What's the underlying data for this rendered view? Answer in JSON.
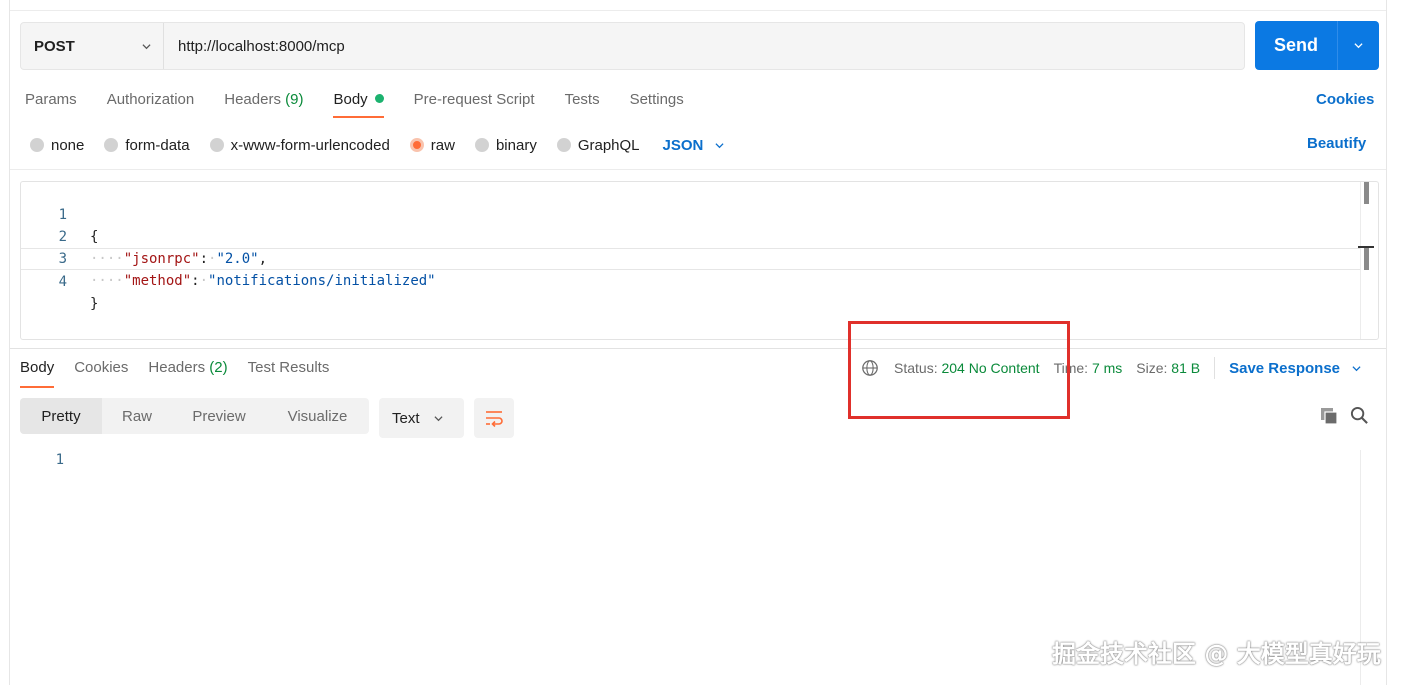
{
  "request": {
    "method": "POST",
    "url": "http://localhost:8000/mcp",
    "send_label": "Send"
  },
  "request_tabs": [
    {
      "label": "Params",
      "active": false
    },
    {
      "label": "Authorization",
      "active": false
    },
    {
      "label": "Headers",
      "count": "(9)",
      "active": false
    },
    {
      "label": "Body",
      "active": true
    },
    {
      "label": "Pre-request Script",
      "active": false
    },
    {
      "label": "Tests",
      "active": false
    },
    {
      "label": "Settings",
      "active": false
    }
  ],
  "cookies_label": "Cookies",
  "body_types": [
    "none",
    "form-data",
    "x-www-form-urlencoded",
    "raw",
    "binary",
    "GraphQL"
  ],
  "body_type_selected": "raw",
  "body_format": "JSON",
  "beautify_label": "Beautify",
  "editor": {
    "line_numbers": [
      "1",
      "2",
      "3",
      "4"
    ],
    "lines": {
      "l1": "{",
      "l2_key": "\"jsonrpc\"",
      "l2_sep": ":",
      "l2_val": "\"2.0\"",
      "l2_end": ",",
      "l3_key": "\"method\"",
      "l3_sep": ":",
      "l3_val": "\"notifications/initialized\"",
      "l4": "}"
    }
  },
  "response_tabs": [
    {
      "label": "Body",
      "active": true
    },
    {
      "label": "Cookies",
      "active": false
    },
    {
      "label": "Headers",
      "count": "(2)",
      "active": false
    },
    {
      "label": "Test Results",
      "active": false
    }
  ],
  "response_meta": {
    "status_label": "Status:",
    "status_value": "204 No Content",
    "time_label": "Time:",
    "time_value": "7 ms",
    "size_label": "Size:",
    "size_value": "81 B",
    "save_label": "Save Response"
  },
  "view_modes": [
    "Pretty",
    "Raw",
    "Preview",
    "Visualize"
  ],
  "view_mode_selected": "Pretty",
  "response_format": "Text",
  "response_line_numbers": [
    "1"
  ],
  "watermark": "掘金技术社区 @ 大模型真好玩",
  "colors": {
    "accent_orange": "#ff6c37",
    "send_blue": "#0b79e3",
    "link_blue": "#0b6fcc",
    "status_green": "#0a8a3a",
    "highlight_red": "#e0302b"
  },
  "icons": [
    "chevron-down-icon",
    "globe-icon",
    "wrap-lines-icon",
    "copy-icon",
    "search-icon"
  ]
}
